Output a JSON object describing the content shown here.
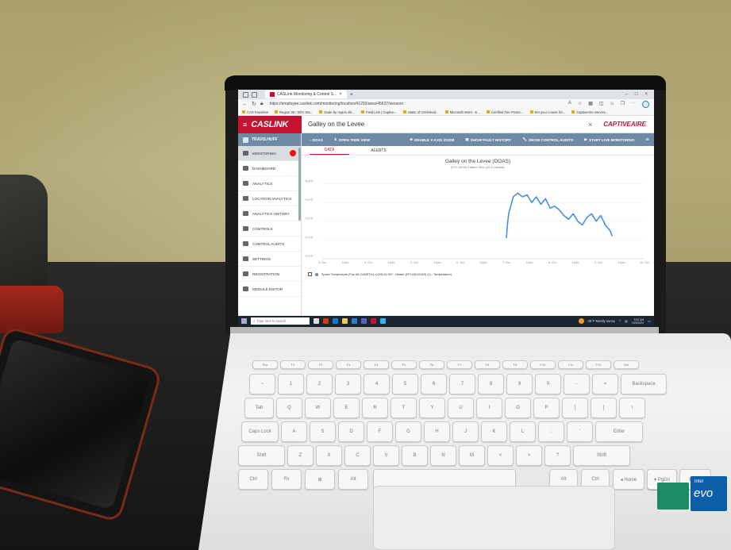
{
  "browser": {
    "tab_title": "CASLink Monitoring & Control S...",
    "url": "https://employee.caslink.com/monitoring/location/41293/area/45637/sensors",
    "favorites": [
      "CAS Favorites",
      "Region 30 / SDV Sta...",
      "Scale by region dis...",
      "Field Link | Captive...",
      "Static of CM-linked...",
      "Microsoft Word - E...",
      "Certified Fire Protec...",
      "Set your course for...",
      "CaptiveAire Service..."
    ]
  },
  "app": {
    "logo": "CASLINK",
    "site_name": "Galley on the Levee",
    "brand_right": "CAPTIVEAIRE",
    "close_glyph": "×"
  },
  "sidebar": {
    "user": "TRAVIS.HUFF",
    "items": [
      {
        "label": "MONITORING",
        "icon": "monitor-icon"
      },
      {
        "label": "DASHBOARD",
        "icon": "dashboard-icon"
      },
      {
        "label": "ANALYTICS",
        "icon": "analytics-icon"
      },
      {
        "label": "LOCATION ANALYTICS",
        "icon": "location-analytics-icon"
      },
      {
        "label": "ANALYTICS HISTORY",
        "icon": "history-icon"
      },
      {
        "label": "CONTROLS",
        "icon": "wrench-icon"
      },
      {
        "label": "CONTROL AUDITS",
        "icon": "wrench-icon"
      },
      {
        "label": "SETTINGS",
        "icon": "gear-icon"
      },
      {
        "label": "REGISTRATION",
        "icon": "registration-icon"
      },
      {
        "label": "MODULE EDITOR",
        "icon": "module-icon"
      }
    ]
  },
  "toolbar": {
    "back": "DOAS",
    "open_tree": "OPEN TREE VIEW",
    "y_zoom": "ENABLE Y-AXIS ZOOM",
    "fault_history": "SHOW FAULT HISTORY",
    "control_audits": "SHOW CONTROL AUDITS",
    "live": "START LIVE MONITORING",
    "menu_glyph": "≡"
  },
  "tabs": {
    "data": "DATA",
    "alerts": "ALERTS"
  },
  "chart_data": {
    "type": "line",
    "title": "Galley on the Levee (DOAS)",
    "subtitle": "(UTC-05:00) Eastern Time (US & Canada)",
    "y_ticks": [
      "75.0°F",
      "74.0°F",
      "73.0°F",
      "72.0°F",
      "71.0°F"
    ],
    "ylim": [
      71,
      75.4
    ],
    "x_ticks": [
      "3. Oct",
      "12pm",
      "4. Oct",
      "12pm",
      "5. Oct",
      "12pm",
      "6. Oct",
      "12pm",
      "7. Oct",
      "12pm",
      "8. Oct",
      "12pm",
      "9. Oct",
      "12pm",
      "10. Oct"
    ],
    "xlim": [
      0,
      14
    ],
    "series": [
      {
        "name": "Space Temperature (Fan #3-CADRTU4-s 009-23-507 - Heater (RTU28-DOAS) (1) - Temperature)",
        "color": "#4a90d9",
        "x": [
          8.0,
          8.05,
          8.1,
          8.3,
          8.5,
          8.7,
          8.9,
          9.1,
          9.3,
          9.5,
          9.7,
          9.9,
          10.1,
          10.3,
          10.5,
          10.7,
          10.9,
          11.1,
          11.3,
          11.5,
          11.7,
          11.9,
          12.1,
          12.3,
          12.5,
          12.6
        ],
        "y": [
          72.1,
          72.9,
          73.4,
          74.3,
          74.5,
          74.3,
          74.4,
          74.0,
          74.3,
          73.9,
          74.2,
          73.7,
          73.8,
          73.6,
          73.3,
          73.1,
          73.4,
          73.0,
          72.8,
          73.2,
          73.4,
          73.0,
          73.3,
          72.8,
          72.5,
          72.2
        ]
      }
    ]
  },
  "taskbar": {
    "search_placeholder": "Type here to search",
    "weather": "46°F  Mostly sunny",
    "time": "9:30 AM",
    "date": "10/9/2023"
  },
  "keyboard": {
    "row1": [
      "Esc",
      "F1",
      "F2",
      "F3",
      "F4",
      "F5",
      "F6",
      "F7",
      "F8",
      "F9",
      "F10",
      "F11",
      "F12",
      "Del"
    ],
    "row2": [
      "~",
      "1",
      "2",
      "3",
      "4",
      "5",
      "6",
      "7",
      "8",
      "9",
      "0",
      "-",
      "=",
      "Backspace"
    ],
    "row3": [
      "Tab",
      "Q",
      "W",
      "E",
      "R",
      "T",
      "Y",
      "U",
      "I",
      "O",
      "P",
      "[",
      "]",
      "\\"
    ],
    "row4": [
      "Caps Lock",
      "A",
      "S",
      "D",
      "F",
      "G",
      "H",
      "J",
      "K",
      "L",
      ";",
      "'",
      "Enter"
    ],
    "row5": [
      "Shift",
      "Z",
      "X",
      "C",
      "V",
      "B",
      "N",
      "M",
      "<",
      ">",
      "?",
      "Shift"
    ],
    "row6": [
      "Ctrl",
      "Fn",
      "⊞",
      "Alt",
      "",
      "Alt",
      "Ctrl",
      "◂ Home",
      "PgUp",
      "▾ PgDn",
      "End ▸"
    ],
    "sticker_intel": "intel",
    "sticker_evo": "evo"
  }
}
